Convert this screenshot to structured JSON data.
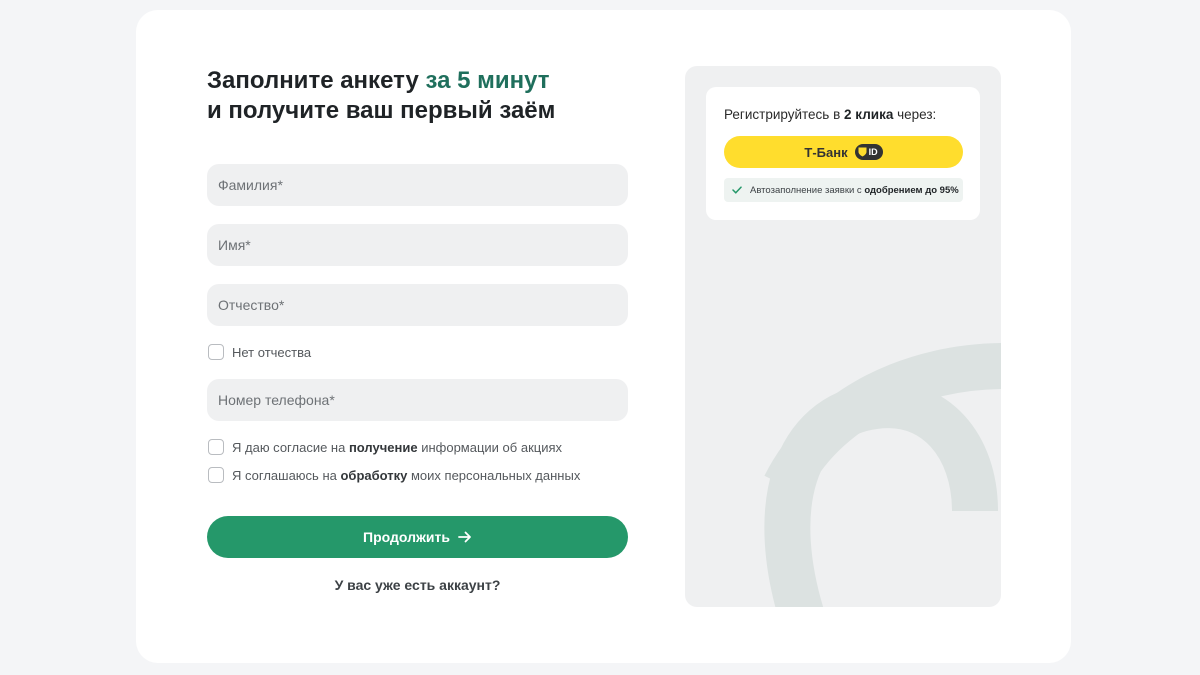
{
  "heading": {
    "line1_plain": "Заполните анкету ",
    "line1_accent": "за 5 минут",
    "line2": "и получите ваш первый заём"
  },
  "form": {
    "last_name_placeholder": "Фамилия*",
    "first_name_placeholder": "Имя*",
    "patronymic_placeholder": "Отчество*",
    "no_patronymic_label": "Нет отчества",
    "phone_placeholder": "Номер телефона*",
    "consent_promo": {
      "prefix": "Я даю согласие на ",
      "bold": "получение",
      "suffix": " информации об акциях"
    },
    "consent_personal": {
      "prefix": "Я соглашаюсь на ",
      "bold": "обработку",
      "suffix": " моих персональных данных"
    },
    "submit_label": "Продолжить",
    "login_link": "У вас уже есть аккаунт?"
  },
  "side_panel": {
    "register_prefix": "Регистрируйтесь в ",
    "register_bold": "2 клика",
    "register_suffix": " через:",
    "tbank_label": "Т-Банк",
    "tbank_badge": "ID",
    "autofill_prefix": "Автозаполнение заявки с ",
    "autofill_bold": "одобрением до 95%"
  },
  "colors": {
    "accent_green": "#25986a",
    "heading_accent": "#1f6f5c",
    "tbank_yellow": "#ffdd2d",
    "field_bg": "#eff0f1",
    "page_bg": "#f4f5f7"
  },
  "icons": [
    "arrow-right-icon",
    "shield-icon",
    "check-icon"
  ]
}
